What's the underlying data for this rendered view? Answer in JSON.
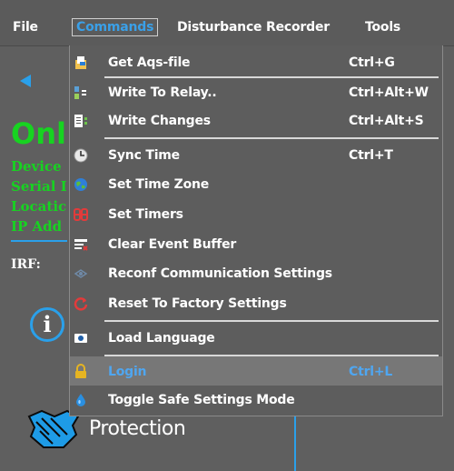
{
  "menubar": {
    "items": [
      "File",
      "Commands",
      "Disturbance Recorder",
      "Tools"
    ]
  },
  "background": {
    "status": "Onl",
    "fields": [
      "Device",
      "Serial I",
      "Locatic",
      "IP Add"
    ],
    "irf_label": "IRF:",
    "info_glyph": "i",
    "protection_label": "Protection",
    "accent_color": "#2aa0ea",
    "status_color": "#17d321"
  },
  "menu": {
    "items": [
      {
        "label": "Get Aqs-file",
        "shortcut": "Ctrl+G",
        "icon": "file-open-icon"
      },
      {
        "label": "Write To Relay..",
        "shortcut": "Ctrl+Alt+W",
        "icon": "write-relay-icon"
      },
      {
        "label": "Write Changes",
        "shortcut": "Ctrl+Alt+S",
        "icon": "write-changes-icon"
      },
      {
        "label": "Sync Time",
        "shortcut": "Ctrl+T",
        "icon": "clock-icon"
      },
      {
        "label": "Set Time Zone",
        "shortcut": "",
        "icon": "globe-icon"
      },
      {
        "label": "Set Timers",
        "shortcut": "",
        "icon": "timer-88-icon"
      },
      {
        "label": "Clear Event Buffer",
        "shortcut": "",
        "icon": "clear-buffer-icon"
      },
      {
        "label": "Reconf Communication Settings",
        "shortcut": "",
        "icon": "network-icon"
      },
      {
        "label": "Reset To Factory Settings",
        "shortcut": "",
        "icon": "reset-icon"
      },
      {
        "label": "Load Language",
        "shortcut": "",
        "icon": "language-icon"
      },
      {
        "label": "Login",
        "shortcut": "Ctrl+L",
        "icon": "lock-icon",
        "disabled": true
      },
      {
        "label": "Toggle Safe Settings Mode",
        "shortcut": "",
        "icon": "drop-icon"
      }
    ]
  }
}
